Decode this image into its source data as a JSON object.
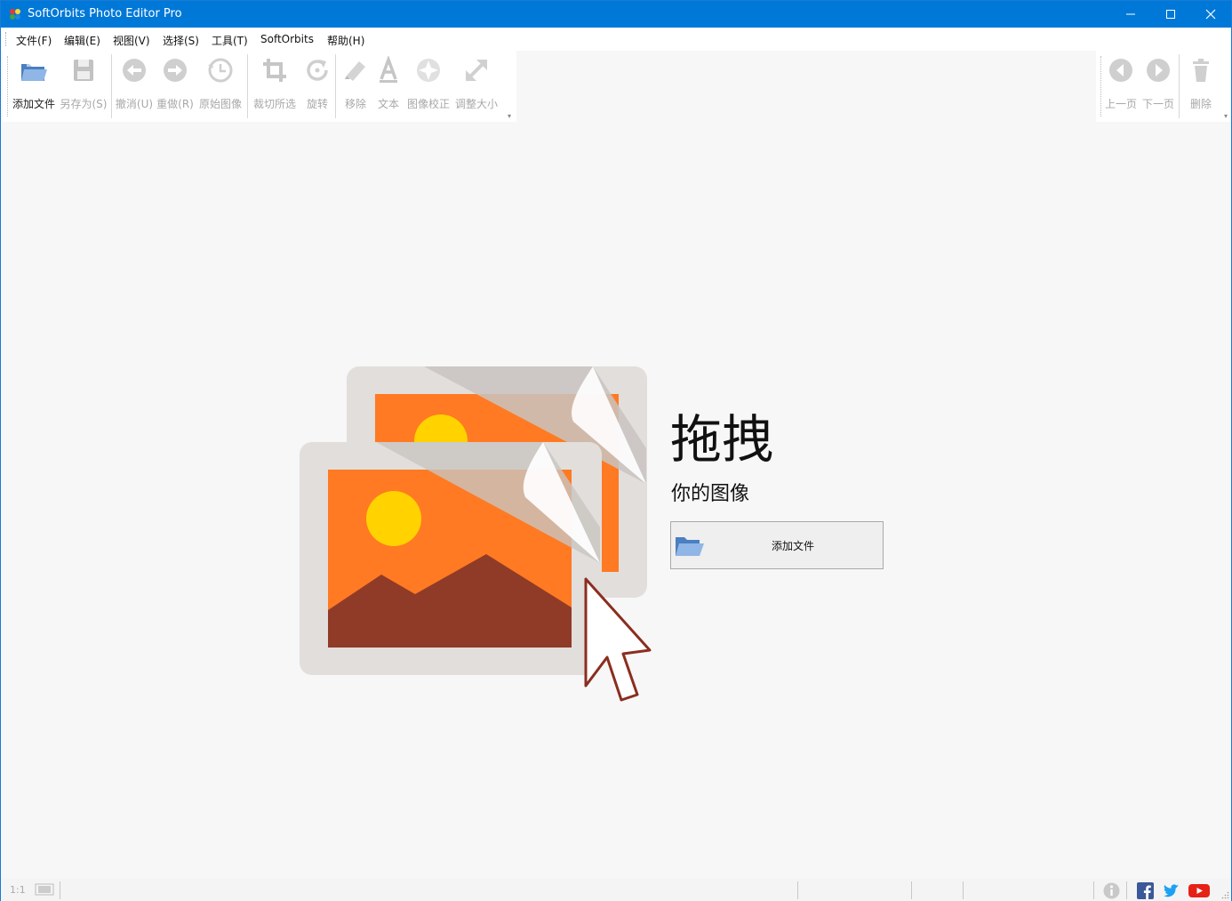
{
  "window": {
    "title": "SoftOrbits Photo Editor Pro"
  },
  "menu": [
    "文件(F)",
    "编辑(E)",
    "视图(V)",
    "选择(S)",
    "工具(T)",
    "SoftOrbits",
    "帮助(H)"
  ],
  "toolbar_left": [
    {
      "label": "添加文件",
      "icon": "folder-open-icon",
      "enabled": true
    },
    {
      "label": "另存为(S)",
      "icon": "save-icon",
      "enabled": false
    },
    {
      "label": "撤消(U)",
      "icon": "undo-icon",
      "enabled": false
    },
    {
      "label": "重做(R)",
      "icon": "redo-icon",
      "enabled": false
    },
    {
      "label": "原始图像",
      "icon": "history-icon",
      "enabled": false
    },
    {
      "label": "裁切所选",
      "icon": "crop-icon",
      "enabled": false
    },
    {
      "label": "旋转",
      "icon": "rotate-icon",
      "enabled": false
    },
    {
      "label": "移除",
      "icon": "eraser-icon",
      "enabled": false
    },
    {
      "label": "文本",
      "icon": "text-icon",
      "enabled": false
    },
    {
      "label": "图像校正",
      "icon": "enhance-icon",
      "enabled": false
    },
    {
      "label": "调整大小",
      "icon": "resize-icon",
      "enabled": false
    }
  ],
  "toolbar_right": [
    {
      "label": "上一页",
      "icon": "previous-icon",
      "enabled": false
    },
    {
      "label": "下一页",
      "icon": "next-icon",
      "enabled": false
    },
    {
      "label": "删除",
      "icon": "trash-icon",
      "enabled": false
    }
  ],
  "main": {
    "drag_title": "拖拽",
    "drag_subtitle": "你的图像",
    "add_button_label": "添加文件"
  },
  "status": {
    "zoom": "1:1"
  },
  "colors": {
    "titlebar": "#0078d7",
    "photo_orange": "#ff7a22",
    "mountain": "#8f3b28",
    "sun": "#ffd200",
    "frame": "#e2dedb"
  }
}
